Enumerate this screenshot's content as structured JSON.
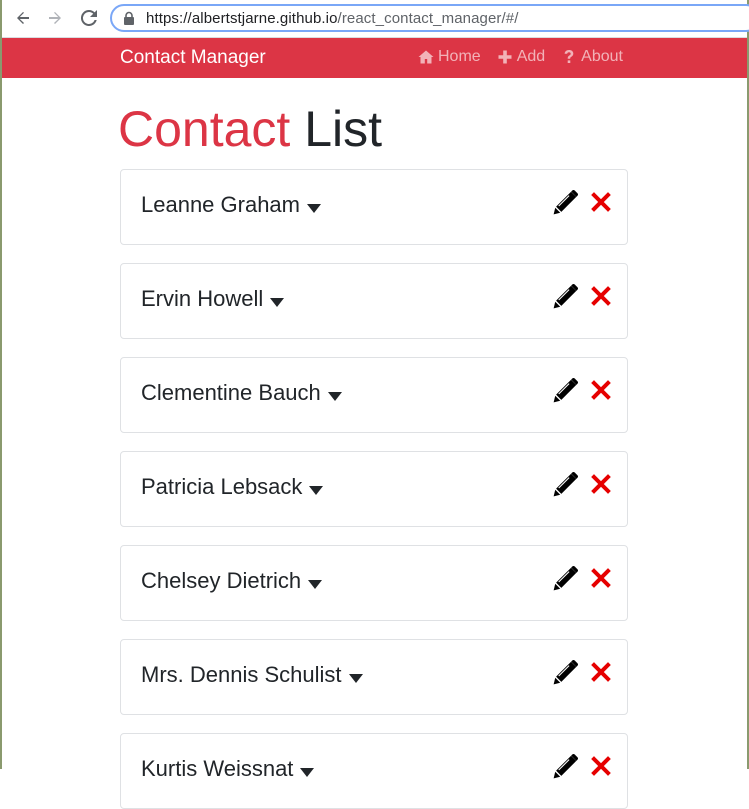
{
  "browser": {
    "url_host": "https://albertstjarne.github.io",
    "url_path": "/react_contact_manager/#/"
  },
  "navbar": {
    "brand": "Contact Manager",
    "links": [
      {
        "label": "Home",
        "icon": "home-icon"
      },
      {
        "label": "Add",
        "icon": "plus-icon"
      },
      {
        "label": "About",
        "icon": "question-icon"
      }
    ]
  },
  "page": {
    "title_accent": "Contact",
    "title_rest": "List"
  },
  "contacts": [
    {
      "name": "Leanne Graham"
    },
    {
      "name": "Ervin Howell"
    },
    {
      "name": "Clementine Bauch"
    },
    {
      "name": "Patricia Lebsack"
    },
    {
      "name": "Chelsey Dietrich"
    },
    {
      "name": "Mrs. Dennis Schulist"
    },
    {
      "name": "Kurtis Weissnat"
    }
  ],
  "colors": {
    "brand": "#dc3545",
    "delete": "#e60000",
    "text": "#212529"
  }
}
